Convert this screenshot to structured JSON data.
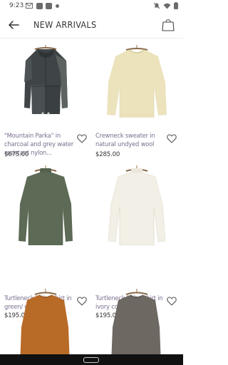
{
  "status_bar": {
    "time": "9:23",
    "icons": [
      "gmail-icon",
      "app-icon",
      "app-icon",
      "dot-icon",
      "mute-icon",
      "wifi-icon",
      "battery-icon"
    ]
  },
  "header": {
    "title": "NEW ARRIVALS",
    "back_icon": "arrow-left-icon",
    "bag_icon": "shopping-bag-icon"
  },
  "products": [
    {
      "name": "\"Mountain Parka\" in charcoal and grey water resistant nylon...",
      "price": "$675.00",
      "colors": [
        "#3f4446",
        "#5d6361"
      ]
    },
    {
      "name": "Crewneck sweater in natural undyed wool",
      "price": "$285.00",
      "colors": [
        "#ece3bd"
      ]
    },
    {
      "name": "Turtleneck knit t-shirt in green/ grey cotton",
      "price": "$195.00",
      "colors": [
        "#5d6a56"
      ]
    },
    {
      "name": "Turtleneck knit t-shirt in ivory cotton",
      "price": "$195.00",
      "colors": [
        "#f2efe6"
      ]
    },
    {
      "name": "",
      "price": "",
      "colors": [
        "#b86a27"
      ]
    },
    {
      "name": "",
      "price": "",
      "colors": [
        "#6e6862"
      ]
    }
  ]
}
